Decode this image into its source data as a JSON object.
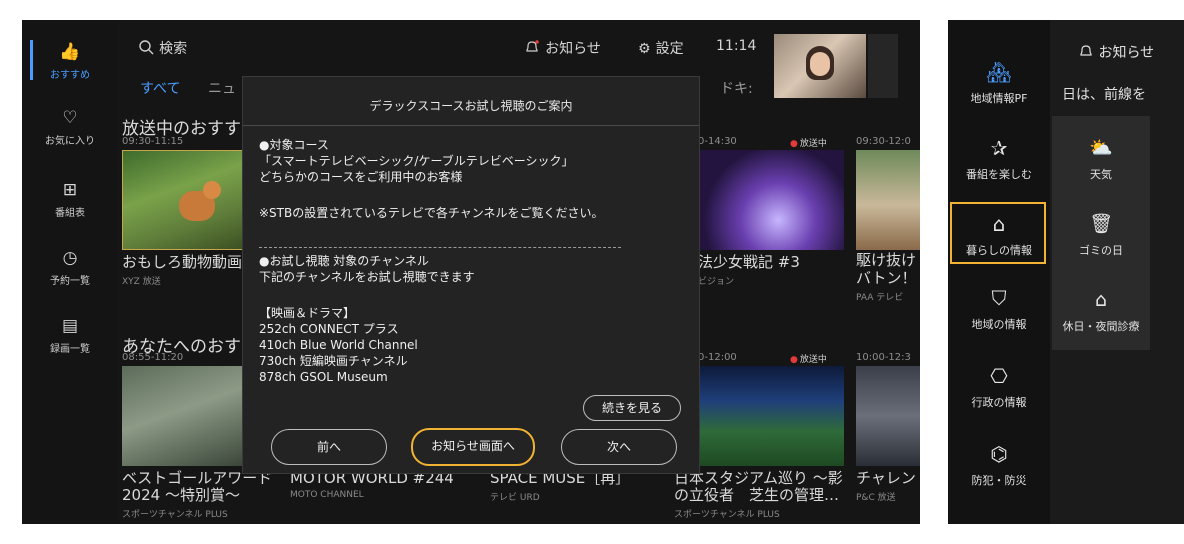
{
  "nav": {
    "items": [
      {
        "label": "おすすめ",
        "icon": "thumbs-up-icon",
        "glyph": "👍"
      },
      {
        "label": "お気に入り",
        "icon": "heart-icon",
        "glyph": "♡"
      },
      {
        "label": "番組表",
        "icon": "grid-icon",
        "glyph": "⊞"
      },
      {
        "label": "予約一覧",
        "icon": "clock-icon",
        "glyph": "◷"
      },
      {
        "label": "録画一覧",
        "icon": "film-icon",
        "glyph": "▤"
      }
    ]
  },
  "topbar": {
    "search_label": "検索",
    "notice_label": "お知らせ",
    "settings_label": "設定",
    "clock": "11:14"
  },
  "tabs": {
    "t1": "すべて",
    "t2": "ニュ",
    "t3": "ドキ:"
  },
  "section1": {
    "title": "放送中のおすす",
    "cards": [
      {
        "time": "09:30-11:15",
        "title": "おもしろ動物動画",
        "channel": "XYZ 放送"
      },
      {
        "time": "0-14:30",
        "live": "放送中",
        "title": "法少女戦記 #3",
        "channel": "ビジョン"
      },
      {
        "time": "09:30-12:0",
        "title1": "駆け抜け",
        "title2": "バトン！",
        "channel": "PAA テレビ"
      }
    ]
  },
  "section2": {
    "title": "あなたへのおす",
    "cards": [
      {
        "time": "08:55-11:20",
        "title1": "ベストゴールアワード",
        "title2": "2024 ～特別賞～",
        "channel": "スポーツチャンネル PLUS"
      },
      {
        "title": "MOTOR WORLD #244",
        "channel": "MOTO CHANNEL"
      },
      {
        "title": "SPACE MUSE［再］",
        "channel": "テレビ URD"
      },
      {
        "time": "0-12:00",
        "live": "放送中",
        "title1": "日本スタジアム巡り ～影",
        "title2": "の立役者　芝生の管理…",
        "channel": "スポーツチャンネル PLUS"
      },
      {
        "time": "10:00-12:3",
        "title": "チャレン",
        "channel": "P&C 放送"
      }
    ]
  },
  "dialog": {
    "title": "デラックスコースお試し視聴のご案内",
    "lines": [
      "●対象コース",
      "「スマートテレビベーシック/ケーブルテレビベーシック」",
      "どちらかのコースをご利用中のお客様",
      "※STBの設置されているテレビで各チャンネルをご覧ください。",
      "●お試し視聴 対象のチャンネル",
      "下記のチャンネルをお試し視聴できます",
      "【映画＆ドラマ】",
      "252ch CONNECT プラス",
      "410ch Blue World Channel",
      "730ch 短編映画チャンネル",
      "878ch GSOL Museum"
    ],
    "more_label": "続きを見る",
    "prev_label": "前へ",
    "notice_label": "お知らせ画面へ",
    "next_label": "次へ"
  },
  "right_panel": {
    "notice_label": "お知らせ",
    "ticker": "日は、前線を",
    "menu": [
      {
        "label": "地域情報PF",
        "icon": "town-info-icon",
        "glyph": "🏘"
      },
      {
        "label": "番組を楽しむ",
        "icon": "sparkle-icon",
        "glyph": "✰"
      },
      {
        "label": "暮らしの情報",
        "icon": "home-info-icon",
        "glyph": "⌂"
      },
      {
        "label": "地域の情報",
        "icon": "map-icon",
        "glyph": "⛉"
      },
      {
        "label": "行政の情報",
        "icon": "government-icon",
        "glyph": "⎔"
      },
      {
        "label": "防犯・防災",
        "icon": "camera-icon",
        "glyph": "⌬"
      }
    ],
    "sub": [
      {
        "label": "天気",
        "icon": "weather-icon",
        "glyph": "⛅"
      },
      {
        "label": "ゴミの日",
        "icon": "trash-calendar-icon",
        "glyph": "🗑"
      },
      {
        "label": "休日・夜間診療",
        "icon": "clinic-icon",
        "glyph": "⌂"
      }
    ]
  },
  "colors": {
    "accent": "#4a9dff",
    "focus": "#f2b233",
    "live": "#e23b3b"
  }
}
